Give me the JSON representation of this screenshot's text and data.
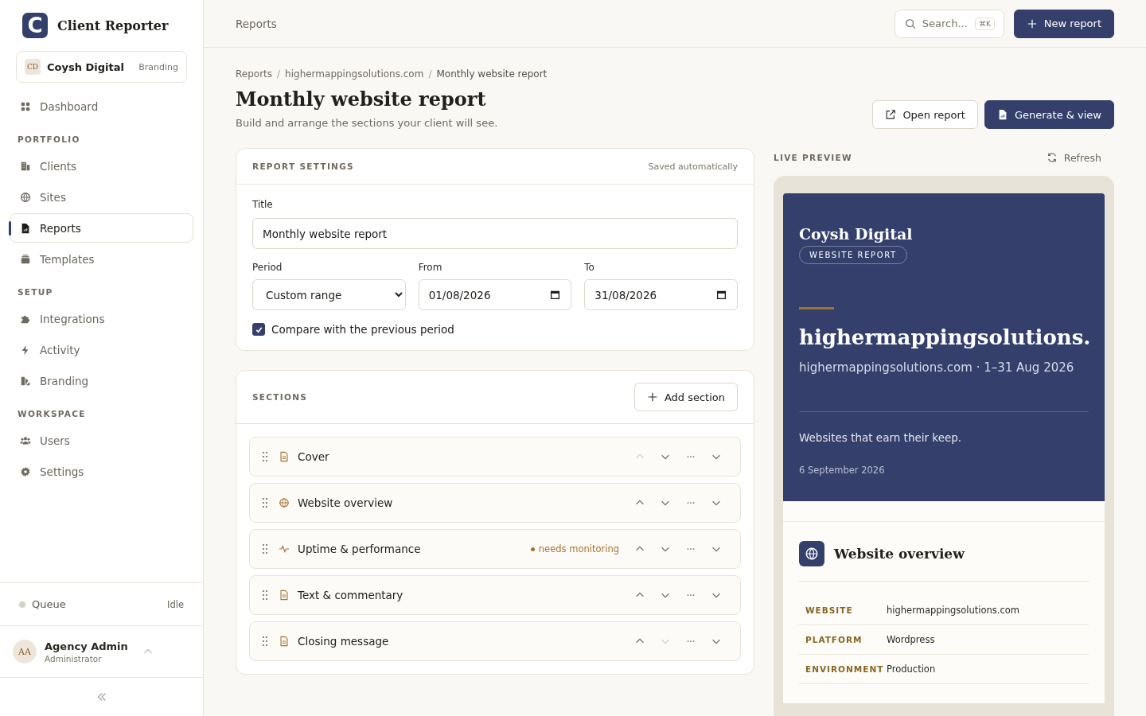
{
  "app": {
    "logo_mark": "C",
    "name": "Client Reporter"
  },
  "workspace": {
    "initials": "CD",
    "name": "Coysh Digital",
    "tag": "Branding"
  },
  "nav": [
    {
      "kind": "item",
      "label": "Dashboard",
      "selected": false
    },
    {
      "kind": "heading",
      "label": "PORTFOLIO"
    },
    {
      "kind": "item",
      "label": "Clients",
      "selected": false
    },
    {
      "kind": "item",
      "label": "Sites",
      "selected": false
    },
    {
      "kind": "item",
      "label": "Reports",
      "selected": true
    },
    {
      "kind": "item",
      "label": "Templates",
      "selected": false
    },
    {
      "kind": "heading",
      "label": "SETUP"
    },
    {
      "kind": "item",
      "label": "Integrations",
      "selected": false
    },
    {
      "kind": "item",
      "label": "Activity",
      "selected": false
    },
    {
      "kind": "item",
      "label": "Branding",
      "selected": false
    },
    {
      "kind": "heading",
      "label": "WORKSPACE"
    },
    {
      "kind": "item",
      "label": "Users",
      "selected": false
    },
    {
      "kind": "item",
      "label": "Settings",
      "selected": false
    }
  ],
  "queue": {
    "label": "Queue",
    "status": "Idle",
    "color": "#d6d1c6"
  },
  "user": {
    "initials": "AA",
    "name": "Agency Admin",
    "role": "Administrator"
  },
  "topbar": {
    "title": "Reports",
    "search_placeholder": "Search...",
    "shortcut": "⌘K",
    "new_button": "New report"
  },
  "breadcrumb": {
    "separator": "/",
    "items": [
      "Reports",
      "highermappingsolutions.com",
      "Monthly website report"
    ]
  },
  "page": {
    "title": "Monthly website report",
    "subtitle": "Build and arrange the sections your client will see.",
    "open_button": "Open report",
    "generate_button": "Generate & view"
  },
  "settings": {
    "heading": "REPORT SETTINGS",
    "note": "Saved automatically",
    "title_label": "Title",
    "title_value": "Monthly website report",
    "period_label": "Period",
    "period_value": "Custom range",
    "from_label": "From",
    "from_value": "01/08/2026",
    "to_label": "To",
    "to_value": "31/08/2026",
    "compare_label": "Compare with the previous period",
    "compare_checked": true
  },
  "sections": {
    "heading": "SECTIONS",
    "add_button": "Add section",
    "items": [
      {
        "name": "Cover",
        "can_move_up": false,
        "can_move_down": true
      },
      {
        "name": "Website overview",
        "can_move_up": true,
        "can_move_down": true
      },
      {
        "name": "Uptime & performance",
        "badge": "needs monitoring",
        "can_move_up": true,
        "can_move_down": true
      },
      {
        "name": "Text & commentary",
        "can_move_up": true,
        "can_move_down": true
      },
      {
        "name": "Closing message",
        "can_move_up": true,
        "can_move_down": false
      }
    ]
  },
  "preview": {
    "heading": "LIVE PREVIEW",
    "refresh": "Refresh",
    "client": "Coysh Digital",
    "tag": "WEBSITE REPORT",
    "site_title": "highermappingsolutions.",
    "meta": "highermappingsolutions.com · 1–31 Aug 2026",
    "tagline": "Websites that earn their keep.",
    "date": "6 September 2026",
    "overview_title": "Website overview",
    "rows": [
      {
        "label": "WEBSITE",
        "value": "highermappingsolutions.com"
      },
      {
        "label": "PLATFORM",
        "value": "Wordpress"
      },
      {
        "label": "ENVIRONMENT",
        "value": "Production"
      }
    ]
  }
}
